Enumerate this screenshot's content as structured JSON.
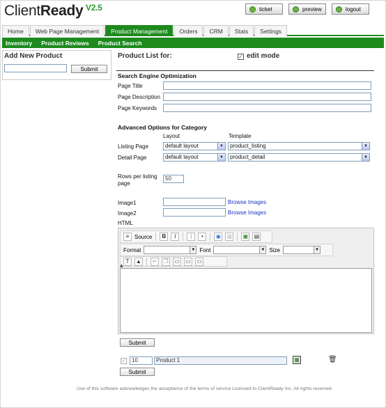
{
  "app": {
    "brand_light": "Client",
    "brand_bold": "Ready",
    "version": "V2.5"
  },
  "top_buttons": {
    "ticket": "ticket",
    "preview": "preview",
    "logout": "logout"
  },
  "tabs": [
    "Home",
    "Web Page Management",
    "Product Management",
    "Orders",
    "CRM",
    "Stats",
    "Settings"
  ],
  "active_tab": "Product Management",
  "subnav": [
    "Inventory",
    "Product Reviews",
    "Product Search"
  ],
  "left": {
    "title": "Add New Product",
    "input_value": "",
    "submit": "Submit"
  },
  "main": {
    "product_list_for": "Product List for:",
    "edit_mode_label": "edit mode",
    "edit_mode_checked": true,
    "seo": {
      "heading": "Search Engine Optimization",
      "page_title_label": "Page Title",
      "page_description_label": "Page Description",
      "page_keywords_label": "Page Keywords",
      "page_title_value": "",
      "page_description_value": "",
      "page_keywords_value": ""
    },
    "advanced": {
      "heading": "Advanced Options for Category",
      "layout_header": "Layout",
      "template_header": "Template",
      "listing_page_label": "Listing Page",
      "detail_page_label": "Detail Page",
      "listing_layout": "default layout",
      "listing_template": "product_listing",
      "detail_layout": "default layout",
      "detail_template": "product_detail"
    },
    "rows_per_listing_label": "Rows per listing page",
    "rows_per_listing_value": "50",
    "image1_label": "Image1",
    "image2_label": "Image2",
    "browse_images": "Browse Images",
    "html_label": "HTML",
    "editor": {
      "source_label": "Source",
      "bold": "B",
      "italic": "I",
      "format_label": "Format",
      "font_label": "Font",
      "size_label": "Size"
    },
    "submit": "Submit"
  },
  "product_row": {
    "checked": true,
    "sort_value": "10",
    "name": "Product 1"
  },
  "product_submit": "Submit",
  "footer": "Use of this software acknowledges the acceptance of the terms of service Licensed to ClientReady Inc. All rights reserved.",
  "colors": {
    "accent": "#1e8a1e",
    "version": "#2f9a2f",
    "link": "#1a35c4"
  }
}
